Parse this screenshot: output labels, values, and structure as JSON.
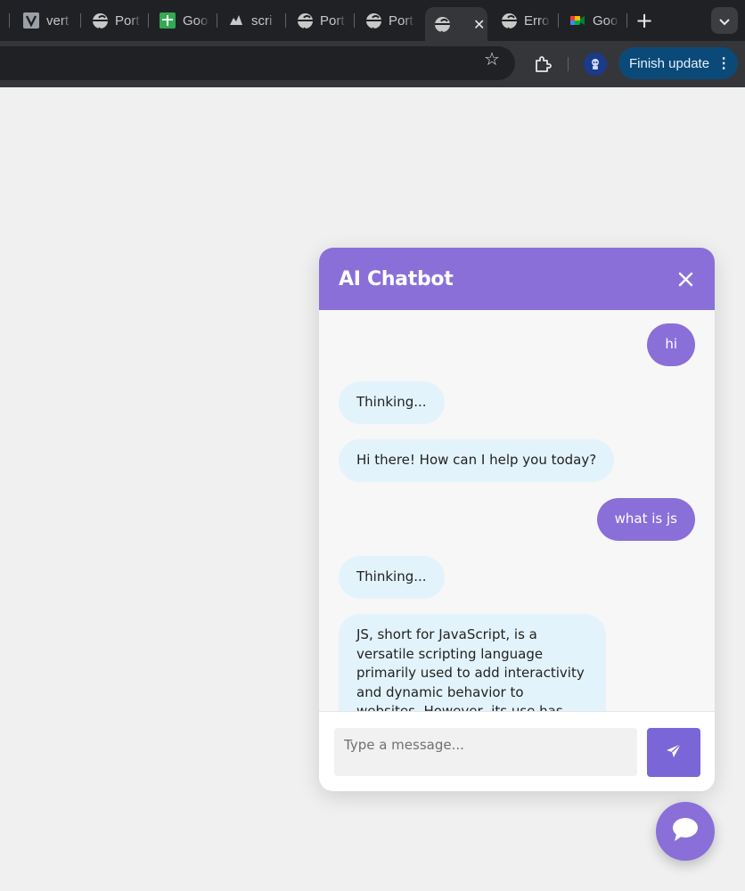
{
  "browser": {
    "tabs": [
      {
        "title": "vert",
        "icon": "v-square-icon"
      },
      {
        "title": "Port",
        "icon": "globe-icon"
      },
      {
        "title": "Goo",
        "icon": "sheets-icon"
      },
      {
        "title": "scri",
        "icon": "script-icon"
      },
      {
        "title": "Port",
        "icon": "globe-icon"
      },
      {
        "title": "Port",
        "icon": "globe-icon"
      },
      {
        "title": "",
        "icon": "globe-icon",
        "active": true
      },
      {
        "title": "Erro",
        "icon": "globe-icon"
      },
      {
        "title": "Goo",
        "icon": "meet-icon"
      }
    ],
    "finish_update_label": "Finish update",
    "accent_color": "#0b4a78"
  },
  "chatbot": {
    "title": "AI Chatbot",
    "accent_color": "#8a6fd8",
    "messages": [
      {
        "role": "user",
        "text": "hi"
      },
      {
        "role": "bot",
        "text": "Thinking..."
      },
      {
        "role": "bot",
        "text": "Hi there! How can I help you today?"
      },
      {
        "role": "user",
        "text": "what is js"
      },
      {
        "role": "bot",
        "text": "Thinking..."
      },
      {
        "role": "bot",
        "text": "JS, short for JavaScript, is a versatile scripting language primarily used to add interactivity and dynamic behavior to websites. However, its use has expanded far beyond the"
      }
    ],
    "input": {
      "placeholder": "Type a message...",
      "value": ""
    },
    "send_icon": "paper-plane-icon",
    "launcher_icon": "chat-bubble-icon"
  }
}
